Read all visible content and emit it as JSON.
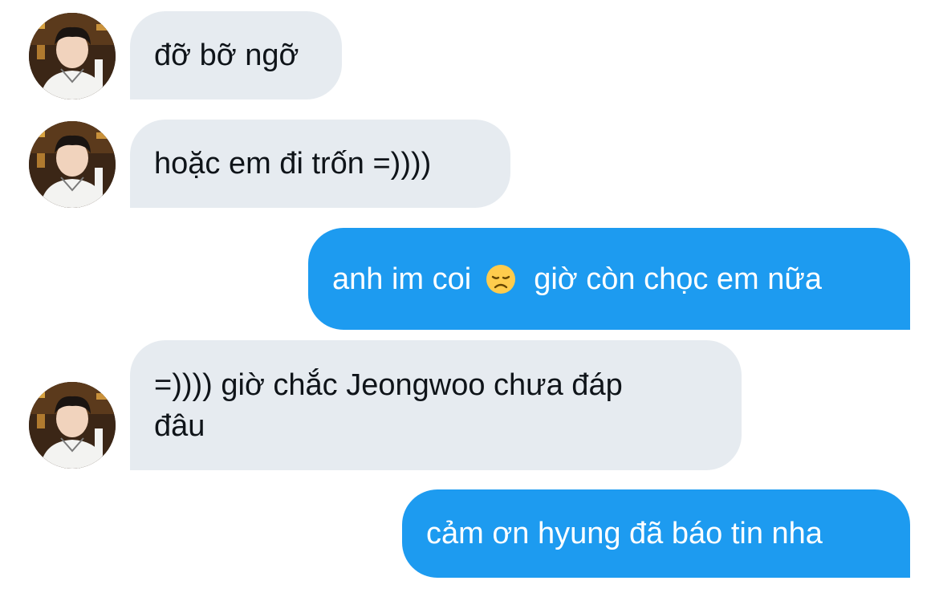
{
  "messages": [
    {
      "side": "received",
      "text": "đỡ bỡ ngỡ"
    },
    {
      "side": "received",
      "text": "hoặc em đi trốn =))))"
    },
    {
      "side": "sent",
      "text_before": "anh im coi",
      "emoji": "disappointed-face-emoji",
      "text_after": "giờ còn chọc em nữa"
    },
    {
      "side": "received",
      "line1": "=)))) giờ chắc Jeongwoo chưa đáp",
      "line2": "đâu"
    },
    {
      "side": "sent",
      "text": "cảm ơn hyung đã báo tin nha"
    }
  ],
  "colors": {
    "received_bubble": "#e6ebf0",
    "sent_bubble": "#1d9bf0",
    "received_text": "#0f1419",
    "sent_text": "#ffffff"
  }
}
